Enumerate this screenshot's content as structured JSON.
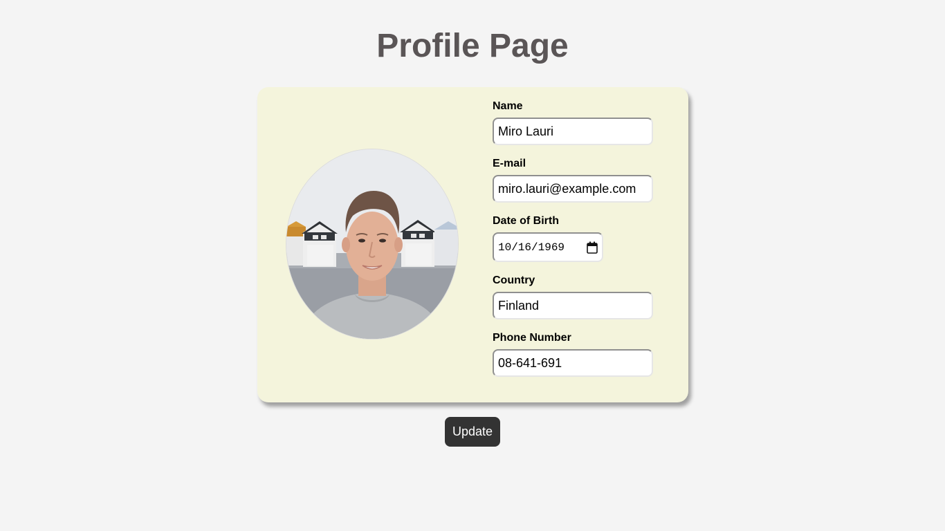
{
  "page": {
    "title": "Profile Page"
  },
  "profile": {
    "avatar_icon": "profile-photo",
    "fields": {
      "name": {
        "label": "Name",
        "value": "Miro Lauri"
      },
      "email": {
        "label": "E-mail",
        "value": "miro.lauri@example.com"
      },
      "dob": {
        "label": "Date of Birth",
        "value": "10/16/1969"
      },
      "country": {
        "label": "Country",
        "value": "Finland"
      },
      "phone": {
        "label": "Phone Number",
        "value": "08-641-691"
      }
    }
  },
  "actions": {
    "update_label": "Update"
  },
  "colors": {
    "background": "#f4f4f4",
    "card": "#f4f4dc",
    "title": "#5a5556",
    "button": "#333333",
    "button_text": "#ffffff"
  }
}
